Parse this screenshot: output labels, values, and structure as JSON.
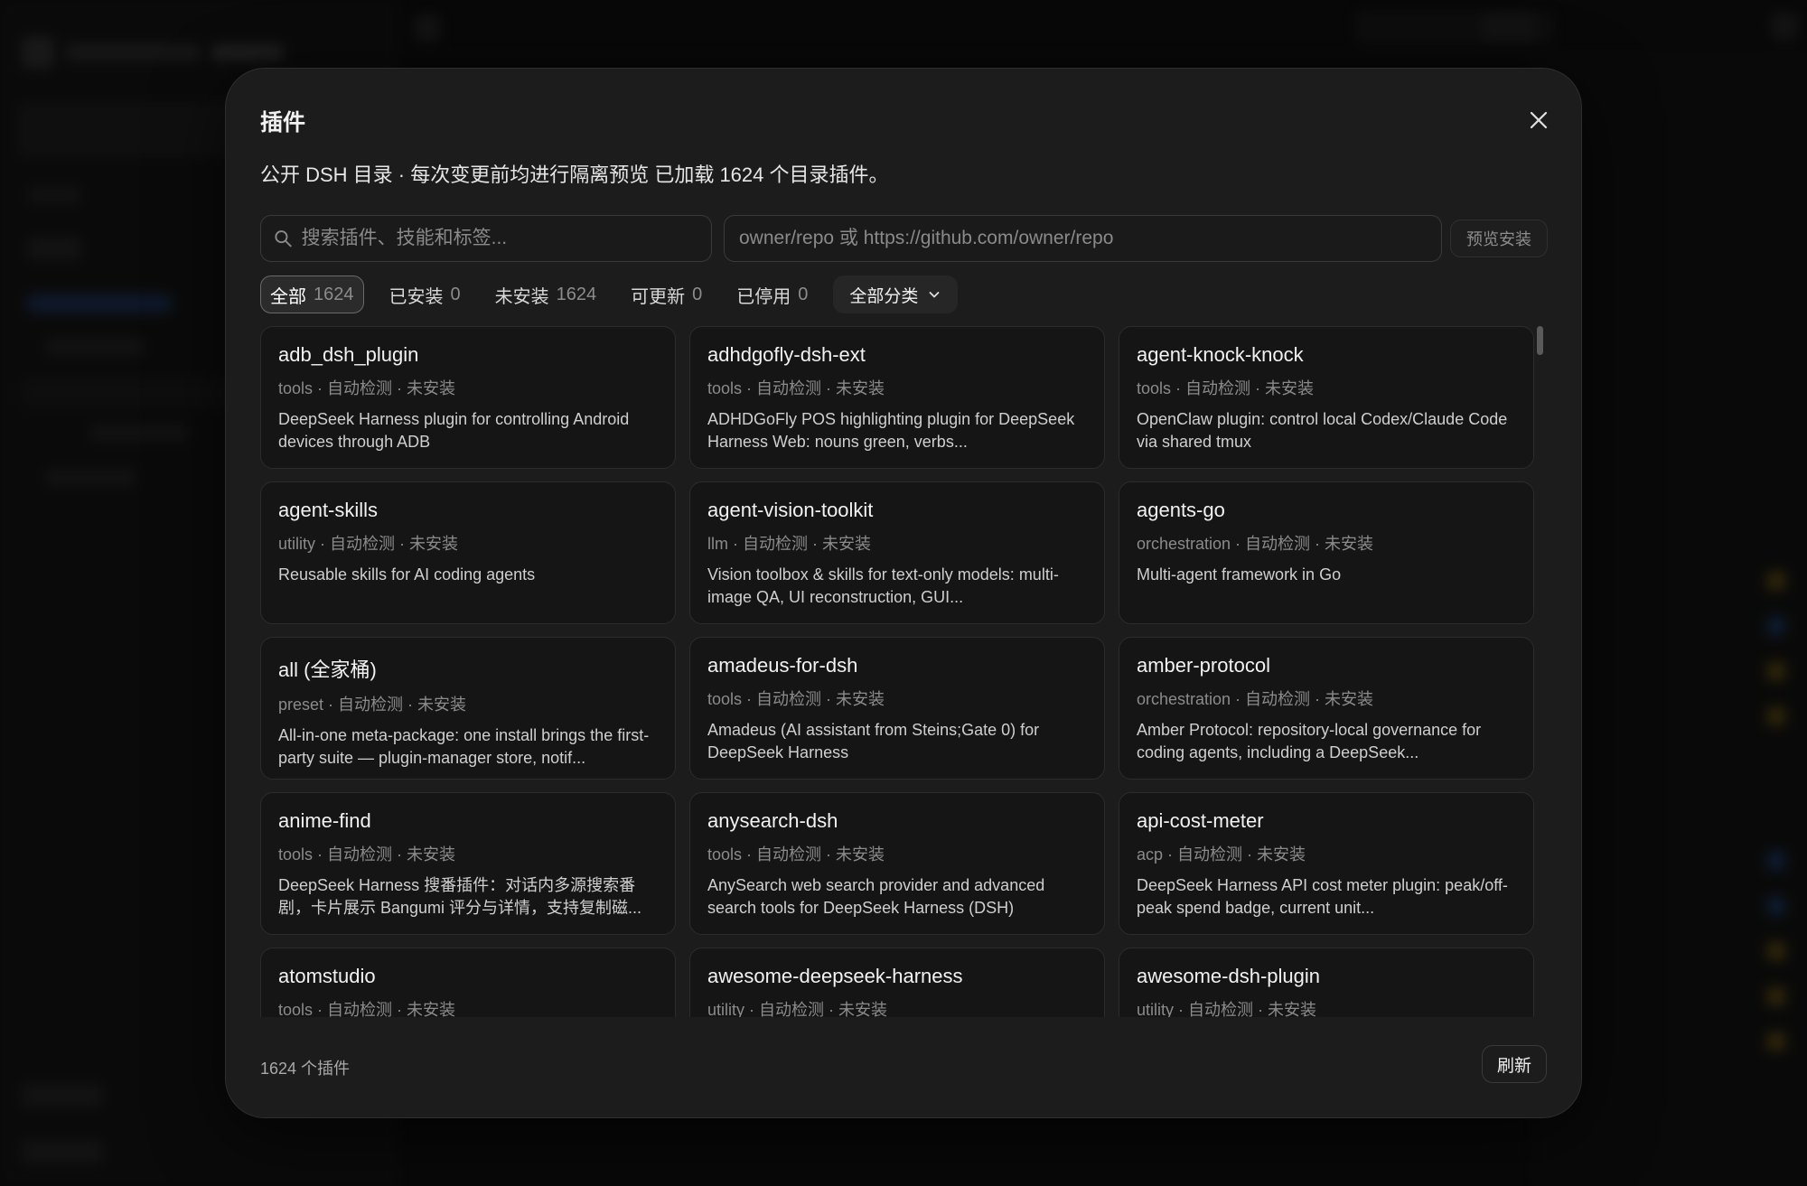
{
  "modal": {
    "title": "插件",
    "subtitle": "公开 DSH 目录 · 每次变更前均进行隔离预览 已加载 1624 个目录插件。",
    "search_placeholder": "搜索插件、技能和标签...",
    "repo_placeholder": "owner/repo 或 https://github.com/owner/repo",
    "preview_install_label": "预览安装",
    "category_label": "全部分类",
    "footer_count": "1624 个插件",
    "refresh_label": "刷新"
  },
  "filters": [
    {
      "label": "全部",
      "count": "1624",
      "active": true
    },
    {
      "label": "已安装",
      "count": "0",
      "active": false
    },
    {
      "label": "未安装",
      "count": "1624",
      "active": false
    },
    {
      "label": "可更新",
      "count": "0",
      "active": false
    },
    {
      "label": "已停用",
      "count": "0",
      "active": false
    }
  ],
  "plugins": [
    {
      "name": "adb_dsh_plugin",
      "meta": "tools · 自动检测 · 未安装",
      "desc": "DeepSeek Harness plugin for controlling Android devices through ADB"
    },
    {
      "name": "adhdgofly-dsh-ext",
      "meta": "tools · 自动检测 · 未安装",
      "desc": "ADHDGoFly POS highlighting plugin for DeepSeek Harness Web: nouns green, verbs..."
    },
    {
      "name": "agent-knock-knock",
      "meta": "tools · 自动检测 · 未安装",
      "desc": "OpenClaw plugin: control local Codex/Claude Code via shared tmux"
    },
    {
      "name": "agent-skills",
      "meta": "utility · 自动检测 · 未安装",
      "desc": "Reusable skills for AI coding agents"
    },
    {
      "name": "agent-vision-toolkit",
      "meta": "llm · 自动检测 · 未安装",
      "desc": "Vision toolbox & skills for text-only models: multi-image QA, UI reconstruction, GUI..."
    },
    {
      "name": "agents-go",
      "meta": "orchestration · 自动检测 · 未安装",
      "desc": "Multi-agent framework in Go"
    },
    {
      "name": "all (全家桶)",
      "meta": "preset · 自动检测 · 未安装",
      "desc": "All-in-one meta-package: one install brings the first-party suite — plugin-manager store, notif..."
    },
    {
      "name": "amadeus-for-dsh",
      "meta": "tools · 自动检测 · 未安装",
      "desc": "Amadeus (AI assistant from Steins;Gate 0) for DeepSeek Harness"
    },
    {
      "name": "amber-protocol",
      "meta": "orchestration · 自动检测 · 未安装",
      "desc": "Amber Protocol: repository-local governance for coding agents, including a DeepSeek..."
    },
    {
      "name": "anime-find",
      "meta": "tools · 自动检测 · 未安装",
      "desc": "DeepSeek Harness 搜番插件：对话内多源搜索番剧，卡片展示 Bangumi 评分与详情，支持复制磁..."
    },
    {
      "name": "anysearch-dsh",
      "meta": "tools · 自动检测 · 未安装",
      "desc": "AnySearch web search provider and advanced search tools for DeepSeek Harness (DSH)"
    },
    {
      "name": "api-cost-meter",
      "meta": "acp · 自动检测 · 未安装",
      "desc": "DeepSeek Harness API cost meter plugin: peak/off-peak spend badge, current unit..."
    },
    {
      "name": "atomstudio",
      "meta": "tools · 自动检测 · 未安装",
      "desc": ""
    },
    {
      "name": "awesome-deepseek-harness",
      "meta": "utility · 自动检测 · 未安装",
      "desc": ""
    },
    {
      "name": "awesome-dsh-plugin",
      "meta": "utility · 自动检测 · 未安装",
      "desc": ""
    }
  ]
}
